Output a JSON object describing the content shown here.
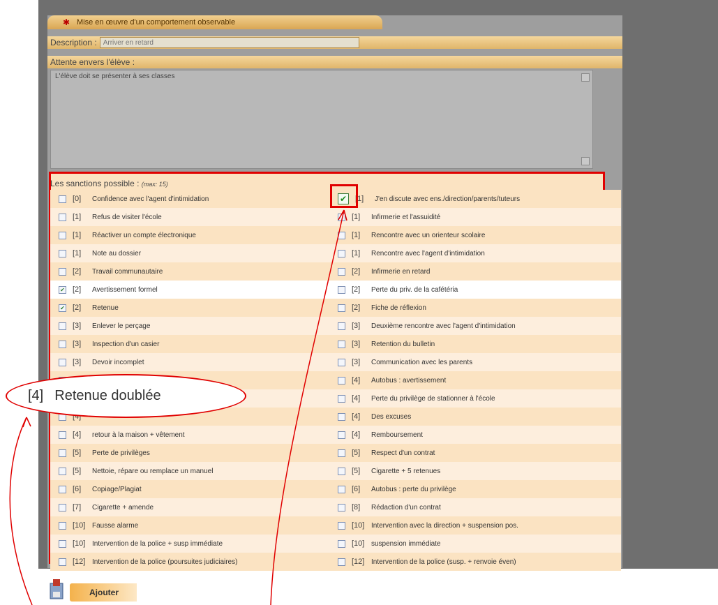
{
  "form": {
    "title": "Mise en œuvre d'un comportement observable",
    "description_label": "Description :",
    "description_value": "Arriver en retard",
    "attente_label": "Attente envers l'élève :",
    "attente_text": "L'élève doit se présenter à ses classes"
  },
  "sanctions": {
    "header": "Les sanctions possible :",
    "max_note": "(max: 15)",
    "left": [
      {
        "code": "[0]",
        "label": "Confidence avec l'agent d'intimidation",
        "checked": false
      },
      {
        "code": "[1]",
        "label": "Refus de visiter l'école",
        "checked": false
      },
      {
        "code": "[1]",
        "label": "Réactiver un compte électronique",
        "checked": false
      },
      {
        "code": "[1]",
        "label": "Note au dossier",
        "checked": false
      },
      {
        "code": "[2]",
        "label": "Travail communautaire",
        "checked": false
      },
      {
        "code": "[2]",
        "label": "Avertissement formel",
        "checked": true
      },
      {
        "code": "[2]",
        "label": "Retenue",
        "checked": true
      },
      {
        "code": "[3]",
        "label": "Enlever le perçage",
        "checked": false
      },
      {
        "code": "[3]",
        "label": "Inspection d'un casier",
        "checked": false
      },
      {
        "code": "[3]",
        "label": "Devoir incomplet",
        "checked": false
      },
      {
        "code": "[4]",
        "label": "Retenue doublée",
        "checked": false
      },
      {
        "code": "[4]",
        "label": "",
        "checked": false
      },
      {
        "code": "[4]",
        "label": "",
        "checked": false
      },
      {
        "code": "[4]",
        "label": "retour à la maison + vêtement",
        "checked": false
      },
      {
        "code": "[5]",
        "label": "Perte de privilèges",
        "checked": false
      },
      {
        "code": "[5]",
        "label": "Nettoie, répare ou remplace un manuel",
        "checked": false
      },
      {
        "code": "[6]",
        "label": "Copiage/Plagiat",
        "checked": false
      },
      {
        "code": "[7]",
        "label": "Cigarette + amende",
        "checked": false
      },
      {
        "code": "[10]",
        "label": "Fausse alarme",
        "checked": false
      },
      {
        "code": "[10]",
        "label": "Intervention de la police + susp immédiate",
        "checked": false
      },
      {
        "code": "[12]",
        "label": "Intervention de la police (poursuites judiciaires)",
        "checked": false
      }
    ],
    "right": [
      {
        "code": "[1]",
        "label": "J'en discute avec ens./direction/parents/tuteurs",
        "checked": true
      },
      {
        "code": "[1]",
        "label": "Infirmerie et l'assuidité",
        "checked": false
      },
      {
        "code": "[1]",
        "label": "Rencontre avec un orienteur scolaire",
        "checked": false
      },
      {
        "code": "[1]",
        "label": "Rencontre avec l'agent d'intimidation",
        "checked": false
      },
      {
        "code": "[2]",
        "label": "Infirmerie en retard",
        "checked": false
      },
      {
        "code": "[2]",
        "label": "Perte du priv. de la cafétéria",
        "checked": false
      },
      {
        "code": "[2]",
        "label": "Fiche de réflexion",
        "checked": false
      },
      {
        "code": "[3]",
        "label": "Deuxième rencontre avec l'agent d'intimidation",
        "checked": false
      },
      {
        "code": "[3]",
        "label": "Retention du bulletin",
        "checked": false
      },
      {
        "code": "[3]",
        "label": "Communication avec les parents",
        "checked": false
      },
      {
        "code": "[4]",
        "label": "Autobus : avertissement",
        "checked": false
      },
      {
        "code": "[4]",
        "label": "Perte du privilège de stationner à l'école",
        "checked": false
      },
      {
        "code": "[4]",
        "label": "Des excuses",
        "checked": false
      },
      {
        "code": "[4]",
        "label": "Remboursement",
        "checked": false
      },
      {
        "code": "[5]",
        "label": "Respect d'un contrat",
        "checked": false
      },
      {
        "code": "[5]",
        "label": "Cigarette + 5 retenues",
        "checked": false
      },
      {
        "code": "[6]",
        "label": "Autobus : perte du privilège",
        "checked": false
      },
      {
        "code": "[8]",
        "label": "Rédaction d'un contrat",
        "checked": false
      },
      {
        "code": "[10]",
        "label": "Intervention avec la direction + suspension pos.",
        "checked": false
      },
      {
        "code": "[10]",
        "label": "suspension immédiate",
        "checked": false
      },
      {
        "code": "[12]",
        "label": "Intervention de la police (susp. + renvoie éven)",
        "checked": false
      }
    ]
  },
  "callout": {
    "code": "[4]",
    "label": "Retenue doublée"
  },
  "ajouter": {
    "label": "Ajouter"
  },
  "icons": {
    "tab": "people-icon",
    "checkbox_checked": "check-icon",
    "ajouter": "save-icon"
  },
  "colors": {
    "accent_red": "#e00000",
    "band": "#f2d08f",
    "row": "#fbe3c2",
    "check": "#2d7f2d"
  }
}
